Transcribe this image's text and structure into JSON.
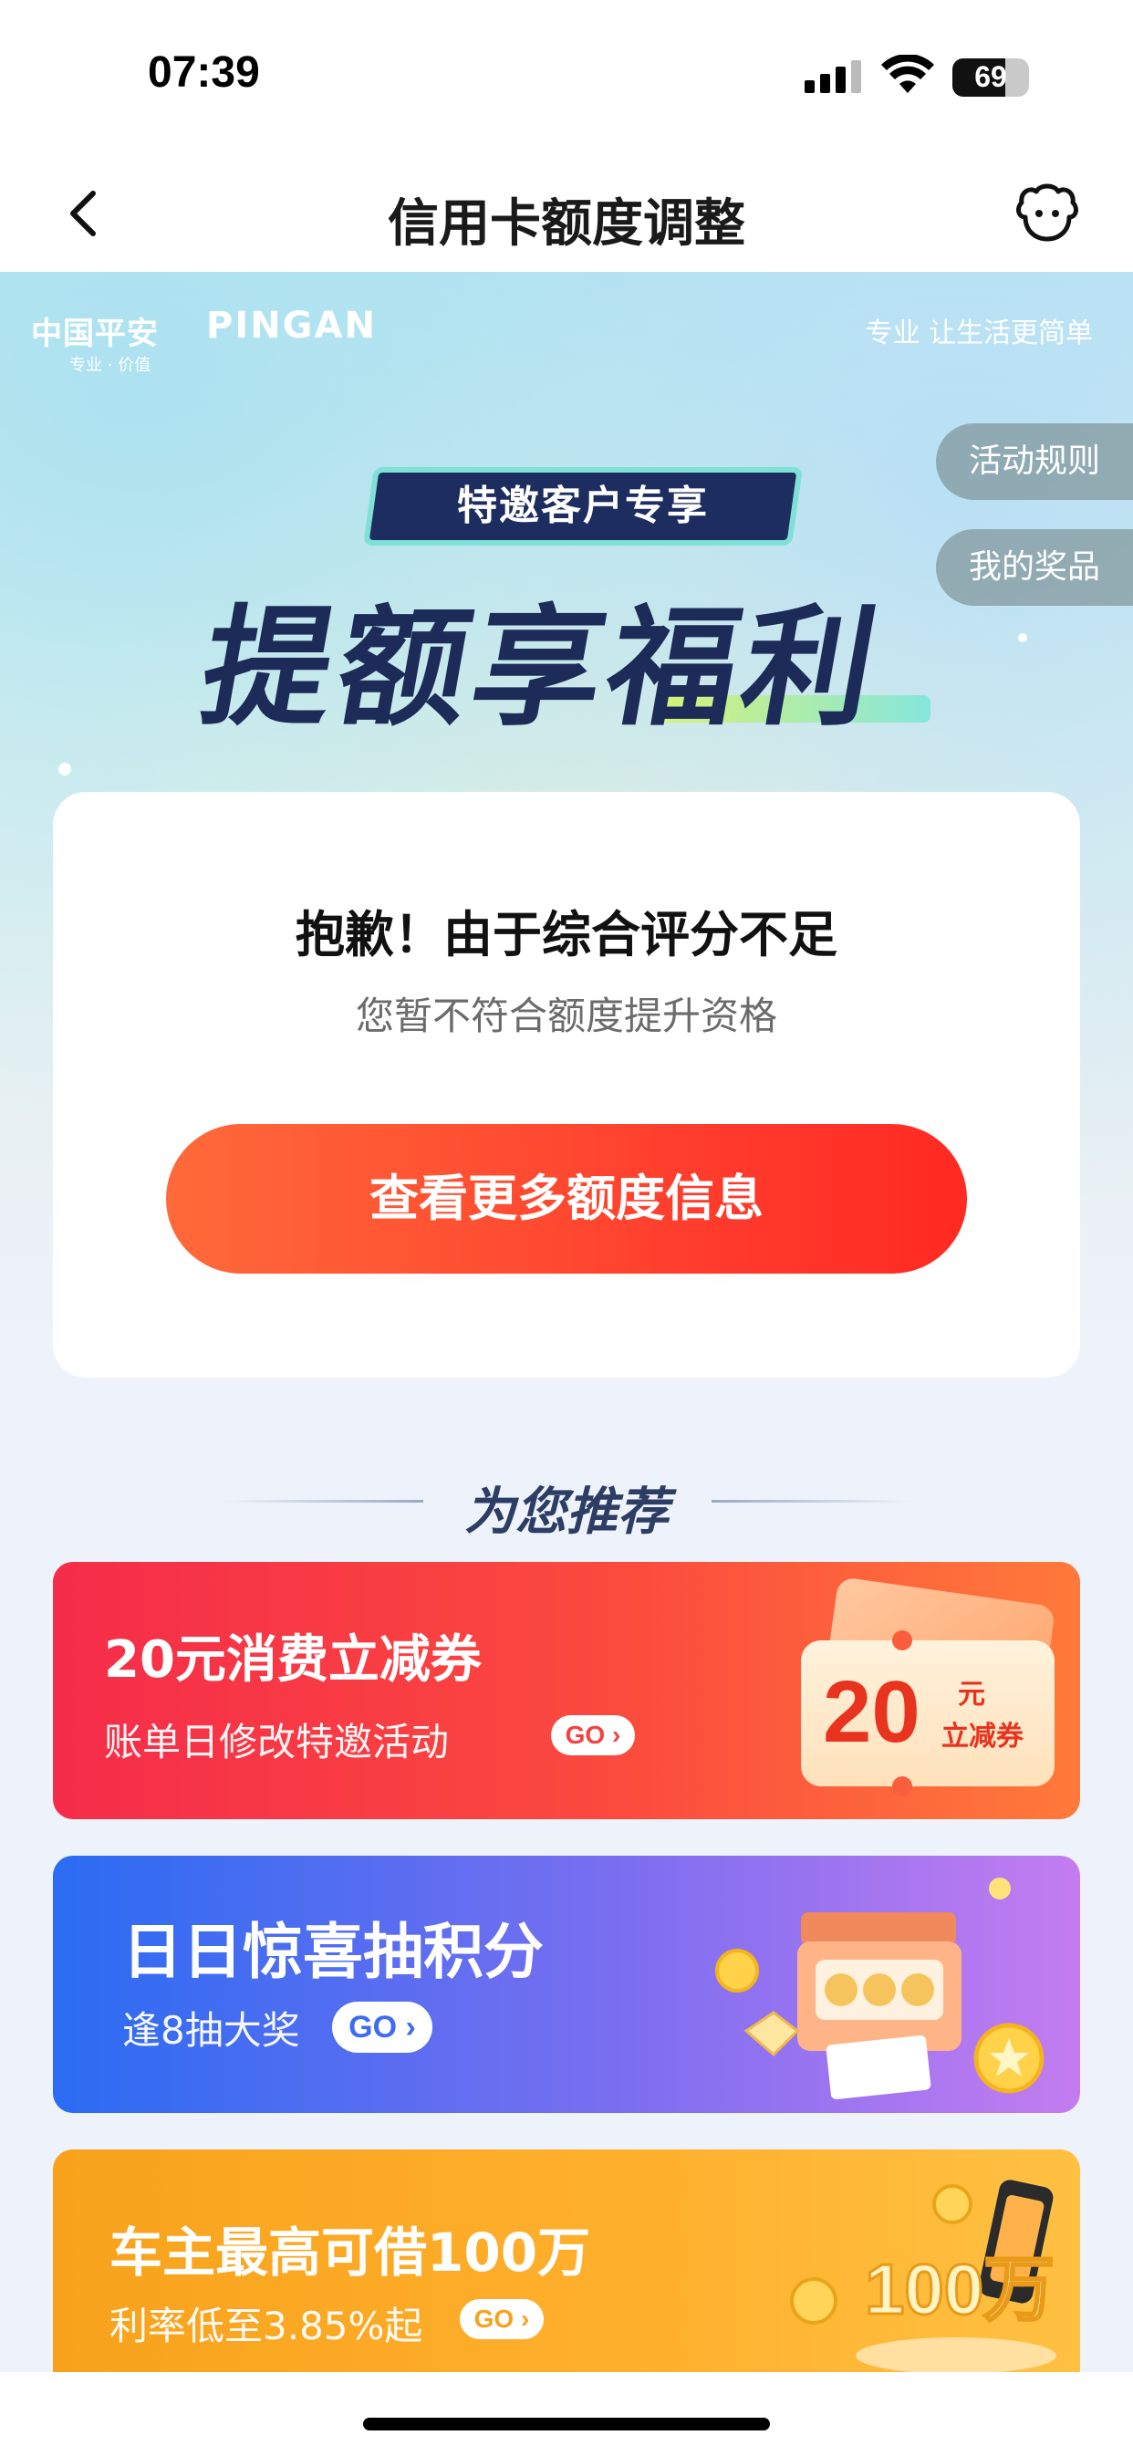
{
  "status_bar": {
    "time": "07:39",
    "battery": "69",
    "battery_level": 0.69
  },
  "nav": {
    "title": "信用卡额度调整",
    "back_icon": "chevron-left-icon",
    "service_icon": "customer-service-icon"
  },
  "hero": {
    "brand_cn": "中国平安",
    "brand_en": "PINGAN",
    "brand_sub": "专业 · 价值",
    "slogan": "专业 让生活更简单",
    "invite_tag": "特邀客户专享",
    "title": "提额享福利",
    "side_buttons": {
      "rules": "活动规则",
      "prizes": "我的奖品"
    }
  },
  "result_card": {
    "title": "抱歉！由于综合评分不足",
    "subtitle": "您暂不符合额度提升资格",
    "cta": "查看更多额度信息"
  },
  "recommend": {
    "header": "为您推荐",
    "items": [
      {
        "title": "20元消费立减券",
        "subtitle": "账单日修改特邀活动",
        "go": "GO",
        "coupon_amount": "20",
        "coupon_unit": "元",
        "coupon_label": "立减券",
        "go_color": "#f5413f"
      },
      {
        "title": "日日惊喜抽积分",
        "subtitle": "逢8抽大奖",
        "go": "GO",
        "go_color": "#3d6bf2"
      },
      {
        "title": "车主最高可借100万",
        "subtitle": "利率低至3.85%起",
        "go": "GO",
        "badge_text": "100万",
        "go_color": "#f8a21c"
      }
    ]
  },
  "colors": {
    "brand_red": "#ff3a2c",
    "navy": "#1c2b58"
  }
}
